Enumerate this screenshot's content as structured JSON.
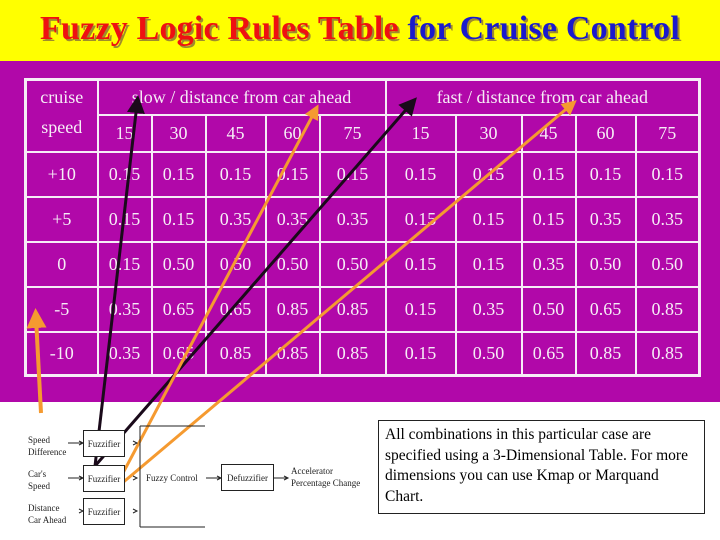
{
  "slide": {
    "title_part1": "Fuzzy Logic Rules Table",
    "title_part2": "for Cruise Control",
    "colors": {
      "title_bg": "#ffff00",
      "title_red": "#ee1111",
      "title_blue": "#1a1acc",
      "table_bg": "#b108a9",
      "arrow_black": "#1a0a1a",
      "arrow_orange": "#f59a30"
    }
  },
  "table": {
    "row_header_line1": "cruise",
    "row_header_line2": "speed",
    "group_slow": "slow / distance from car ahead",
    "group_fast": "fast / distance from car ahead",
    "distances": [
      "15",
      "30",
      "45",
      "60",
      "75"
    ],
    "rows": [
      {
        "speed": "+10",
        "slow": [
          "0.15",
          "0.15",
          "0.15",
          "0.15",
          "0.15"
        ],
        "fast": [
          "0.15",
          "0.15",
          "0.15",
          "0.15",
          "0.15"
        ]
      },
      {
        "speed": "+5",
        "slow": [
          "0.15",
          "0.15",
          "0.35",
          "0.35",
          "0.35"
        ],
        "fast": [
          "0.15",
          "0.15",
          "0.15",
          "0.35",
          "0.35"
        ]
      },
      {
        "speed": "0",
        "slow": [
          "0.15",
          "0.50",
          "0.50",
          "0.50",
          "0.50"
        ],
        "fast": [
          "0.15",
          "0.15",
          "0.35",
          "0.50",
          "0.50"
        ]
      },
      {
        "speed": "-5",
        "slow": [
          "0.35",
          "0.65",
          "0.65",
          "0.85",
          "0.85"
        ],
        "fast": [
          "0.15",
          "0.35",
          "0.50",
          "0.65",
          "0.85"
        ]
      },
      {
        "speed": "-10",
        "slow": [
          "0.35",
          "0.65",
          "0.85",
          "0.85",
          "0.85"
        ],
        "fast": [
          "0.15",
          "0.50",
          "0.65",
          "0.85",
          "0.85"
        ]
      }
    ]
  },
  "diagram": {
    "input1_line1": "Speed",
    "input1_line2": "Difference",
    "input2_line1": "Car's",
    "input2_line2": "Speed",
    "input3_line1": "Distance",
    "input3_line2": "Car Ahead",
    "fuzzifier1": "Fuzzifier",
    "fuzzifier2": "Fuzzifier",
    "fuzzifier3": "Fuzzifier",
    "fuzzy_control": "Fuzzy Control",
    "defuzzifier": "Defuzzifier",
    "output_line1": "Accelerator",
    "output_line2": "Percentage Change"
  },
  "note": {
    "text": "All combinations in this particular case are specified using a 3-Dimensional Table. For more dimensions you can use Kmap or Marquand Chart."
  }
}
